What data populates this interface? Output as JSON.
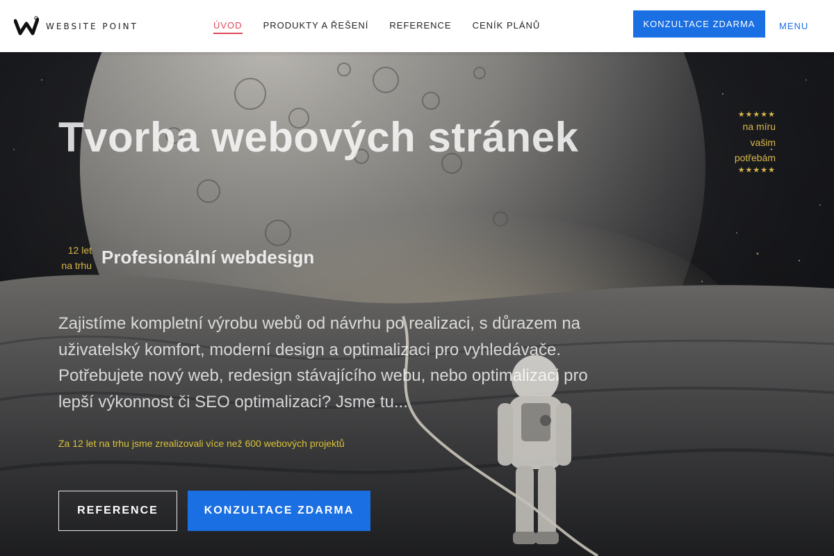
{
  "header": {
    "logo_text": "WEBSITE POINT",
    "nav": [
      {
        "label": "ÚVOD",
        "active": true
      },
      {
        "label": "PRODUKTY A ŘEŠENÍ",
        "active": false
      },
      {
        "label": "REFERENCE",
        "active": false
      },
      {
        "label": "CENÍK PLÁNŮ",
        "active": false
      }
    ],
    "cta_label": "KONZULTACE ZDARMA",
    "menu_label": "MENU"
  },
  "hero": {
    "title": "Tvorba webových stránek",
    "side_tag": {
      "stars_top": "★★★★★",
      "lines": [
        "na míru",
        "vašim",
        "potřebám"
      ],
      "stars_bottom": "★★★★★"
    },
    "years_line1": "12 let",
    "years_line2": "na trhu",
    "subtitle": "Profesionální webdesign",
    "intro": "Zajistíme kompletní výrobu webů od návrhu po realizaci, s důrazem na uživatelský komfort, moderní design a optimalizaci pro vyhledávače. Potřebujete nový web, redesign stávajícího webu, nebo optimalizaci pro lepší výkonnost či SEO optimalizaci? Jsme tu...",
    "stat_line": "Za 12 let na trhu jsme zrealizovali více než 600 webových projektů",
    "button_reference": "REFERENCE",
    "button_consult": "KONZULTACE ZDARMA"
  },
  "colors": {
    "accent_blue": "#1a6fe3",
    "active_nav": "#e0465a",
    "gold": "#d9b84a"
  },
  "icons": {
    "logo": "website-point-logo-icon"
  }
}
